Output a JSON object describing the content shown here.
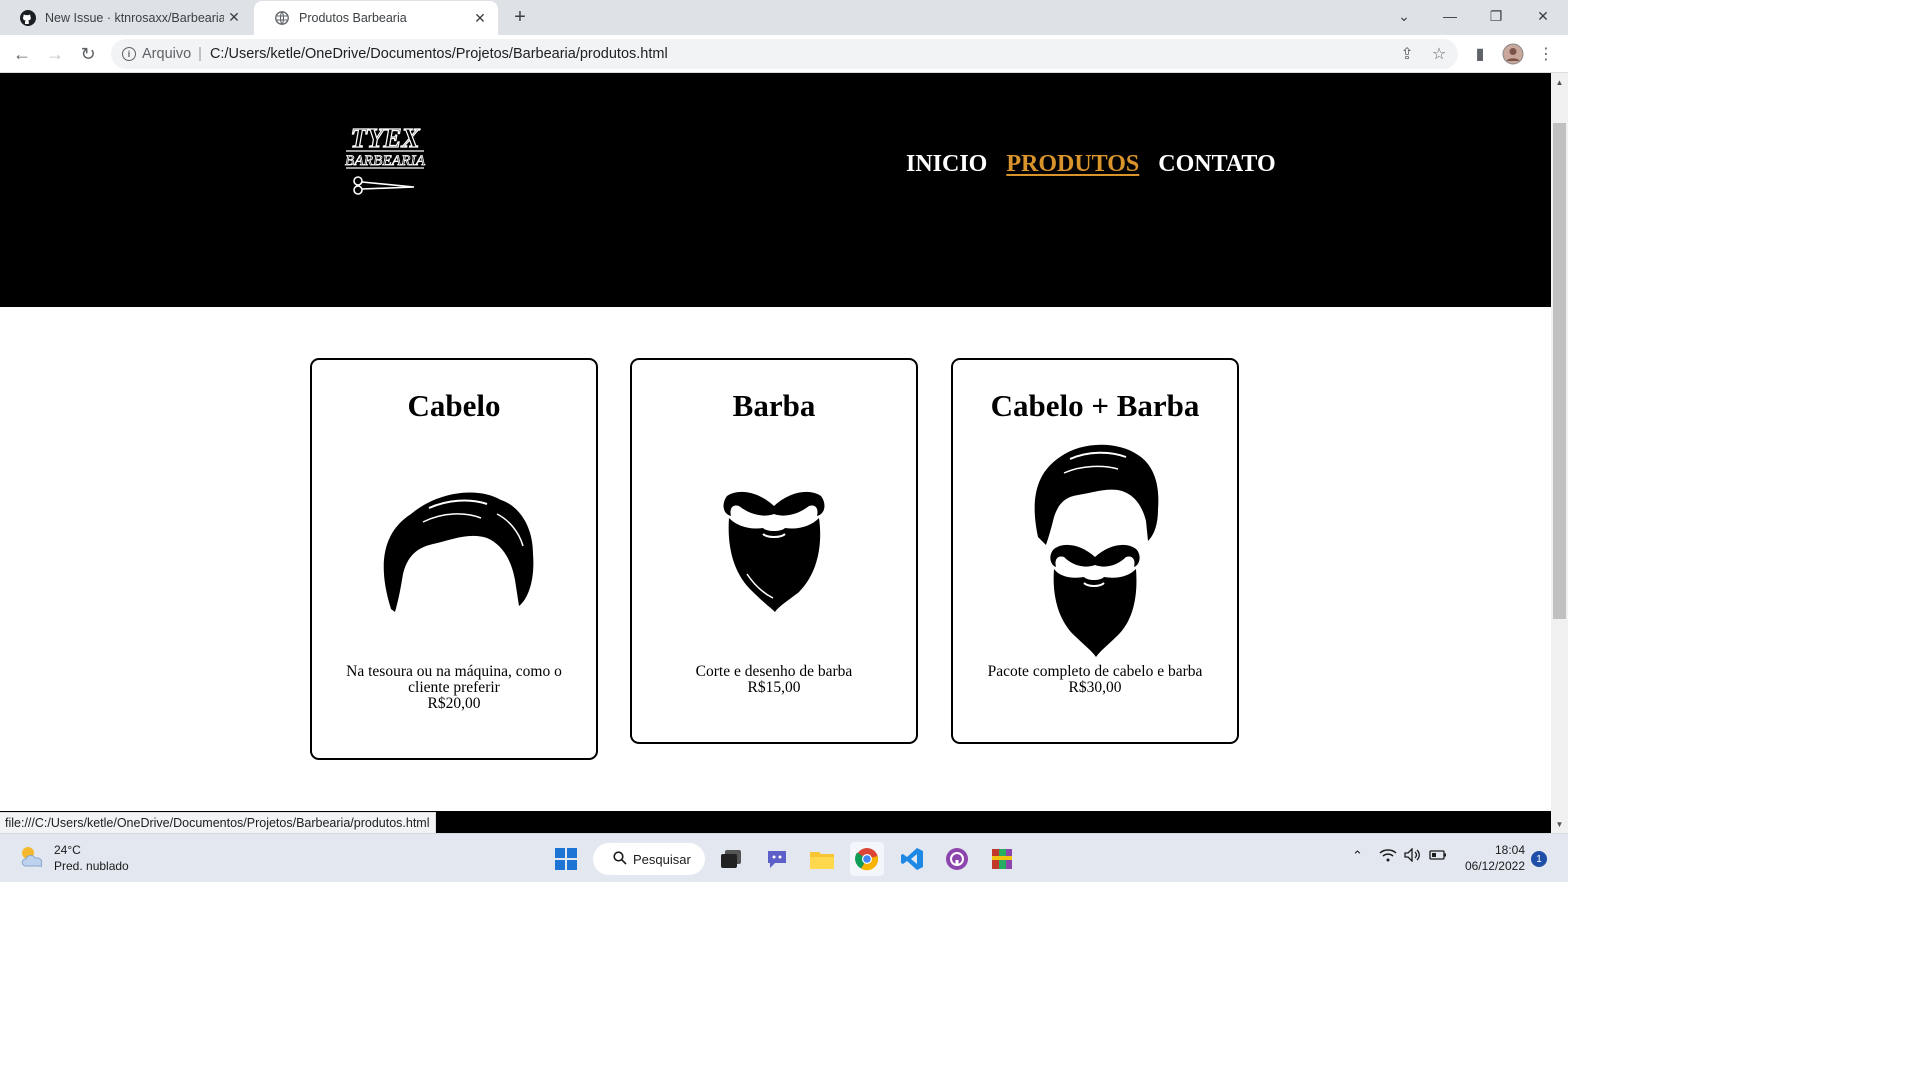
{
  "browser": {
    "tabs": [
      {
        "title": "New Issue · ktnrosaxx/Barbearia",
        "icon": "github-icon"
      },
      {
        "title": "Produtos Barbearia",
        "icon": "globe-icon"
      }
    ],
    "address": {
      "chip": "Arquivo",
      "url": "C:/Users/ketle/OneDrive/Documentos/Projetos/Barbearia/produtos.html"
    },
    "status_url": "file:///C:/Users/ketle/OneDrive/Documentos/Projetos/Barbearia/produtos.html"
  },
  "site": {
    "logo": {
      "line1": "TYEX",
      "line2": "BARBEARIA"
    },
    "nav": [
      {
        "label": "INICIO",
        "active": false
      },
      {
        "label": "PRODUTOS",
        "active": true
      },
      {
        "label": "CONTATO",
        "active": false
      }
    ],
    "accent_color": "#d9952c",
    "products": [
      {
        "title": "Cabelo",
        "description": "Na tesoura ou na máquina, como o cliente preferir",
        "price": "R$20,00",
        "icon": "hair-icon"
      },
      {
        "title": "Barba",
        "description": "Corte e desenho de barba",
        "price": "R$15,00",
        "icon": "beard-icon"
      },
      {
        "title": "Cabelo + Barba",
        "description": "Pacote completo de cabelo e barba",
        "price": "R$30,00",
        "icon": "hair-and-beard-icon"
      }
    ]
  },
  "taskbar": {
    "weather": {
      "temp": "24°C",
      "condition": "Pred. nublado"
    },
    "search_label": "Pesquisar",
    "time": "18:04",
    "date": "06/12/2022",
    "notifications": "1"
  }
}
